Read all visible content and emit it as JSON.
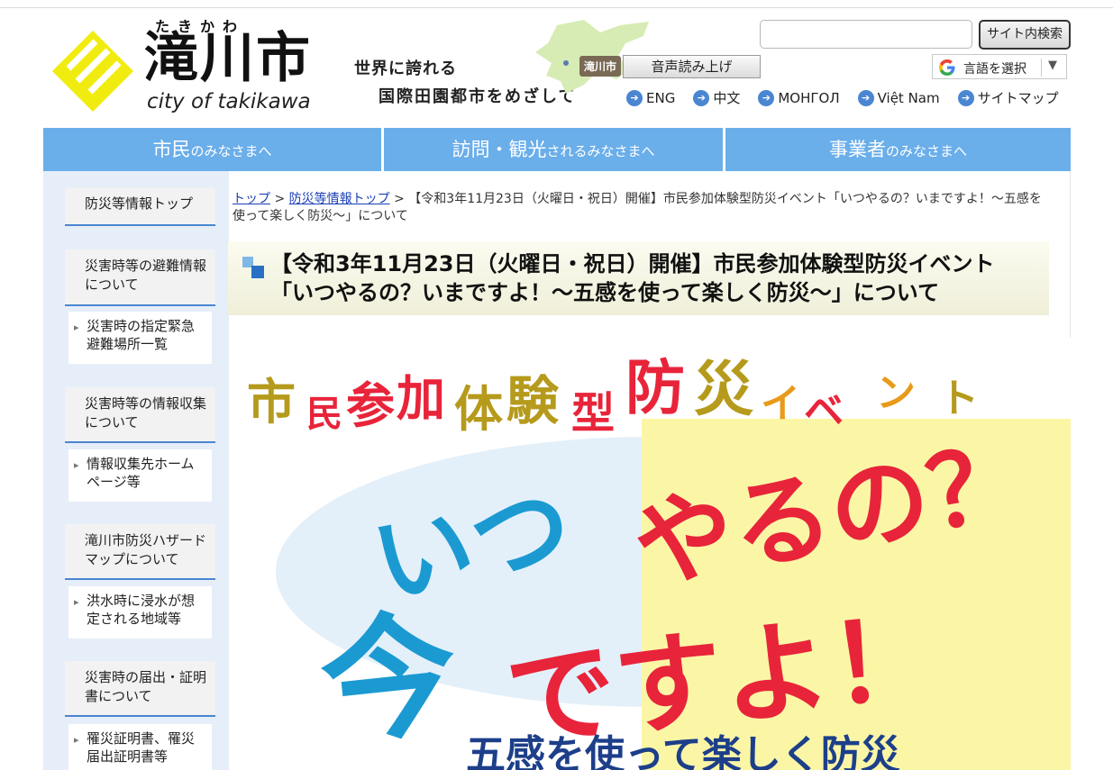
{
  "header": {
    "logo_kana": "たきかわ",
    "logo_kanji": "滝川市",
    "logo_roman": "city of takikawa",
    "slogan_line1": "世界に誇れる",
    "slogan_line2": "国際田園都市をめざして",
    "map_tag": "滝川市",
    "speech_button": "音声読み上げ",
    "search_placeholder": "",
    "search_button": "サイト内検索",
    "translate_label": "言語を選択",
    "lang_links": [
      "ENG",
      "中文",
      "МОНГОЛ",
      "Việt Nam",
      "サイトマップ"
    ]
  },
  "nav": {
    "tabs": [
      {
        "big": "市民",
        "small": "のみなさまへ"
      },
      {
        "big": "訪問・観光",
        "small": "されるみなさまへ"
      },
      {
        "big": "事業者",
        "small": "のみなさまへ"
      }
    ]
  },
  "sidebar": {
    "items": [
      {
        "type": "head",
        "label": "防災等情報トップ"
      },
      {
        "type": "head",
        "label": "災害時等の避難情報について"
      },
      {
        "type": "sub",
        "label": "災害時の指定緊急避難場所一覧"
      },
      {
        "type": "head",
        "label": "災害時等の情報収集について"
      },
      {
        "type": "sub",
        "label": "情報収集先ホームページ等"
      },
      {
        "type": "head",
        "label": "滝川市防災ハザードマップについて"
      },
      {
        "type": "sub",
        "label": "洪水時に浸水が想定される地域等"
      },
      {
        "type": "head",
        "label": "災害時の届出・証明書について"
      },
      {
        "type": "sub",
        "label": "罹災証明書、罹災届出証明書等"
      }
    ]
  },
  "breadcrumb": {
    "top": "トップ",
    "sep": ">",
    "section": "防災等情報トップ",
    "current": "【令和3年11月23日（火曜日・祝日）開催】市民参加体験型防災イベント「いつやるの？いまですよ！～五感を使って楽しく防災～」について"
  },
  "page_title": "【令和3年11月23日（火曜日・祝日）開催】市民参加体験型防災イベント「いつやるの？いまですよ！～五感を使って楽しく防災～」について",
  "poster": {
    "headline_chars": [
      "市",
      "民",
      "参",
      "加",
      "体",
      "験",
      "型",
      "防",
      "災",
      "イ",
      "ベ",
      "ン",
      "ト"
    ],
    "line_itsu": "いつ",
    "line_yaruno": "やるの？",
    "line_ima": "今",
    "line_desuyo": "ですよ！",
    "bottom_text": "五感を使って楽しく防災",
    "colors": {
      "blue": "#1b9ad2",
      "red": "#e8243a",
      "olive": "#b59a1c",
      "yellow_bg": "#fbf6a6",
      "blue_bg": "#e3f0fa",
      "navy": "#1d3f8a"
    }
  }
}
